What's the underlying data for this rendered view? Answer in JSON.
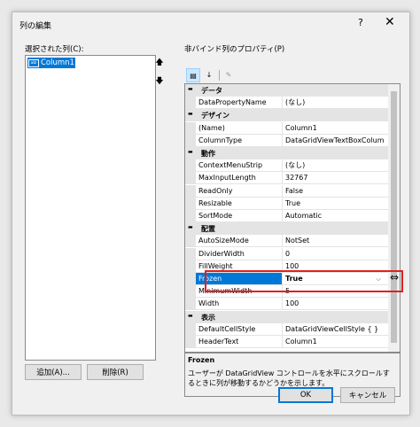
{
  "dialog": {
    "title": "列の編集",
    "help_label": "?",
    "close_label": "✕"
  },
  "left": {
    "label": "選択された列(C):",
    "items": [
      {
        "label": "Column1",
        "icon": "abl"
      }
    ],
    "up_label": "🡅",
    "down_label": "🡇",
    "add_button": "追加(A)...",
    "remove_button": "削除(R)"
  },
  "right": {
    "label": "非バインド列のプロパティ(P)",
    "toolbar": {
      "categorized_icon": "categorized-icon",
      "alphabetical_icon": "alphabetical-icon",
      "property_pages_icon": "wrench-icon"
    }
  },
  "grid": {
    "rows": [
      {
        "type": "cat",
        "label": "データ"
      },
      {
        "type": "prop",
        "name": "DataPropertyName",
        "value": "(なし)"
      },
      {
        "type": "cat",
        "label": "デザイン"
      },
      {
        "type": "prop",
        "name": "(Name)",
        "value": "Column1"
      },
      {
        "type": "prop",
        "name": "ColumnType",
        "value": "DataGridViewTextBoxColum"
      },
      {
        "type": "cat",
        "label": "動作"
      },
      {
        "type": "prop",
        "name": "ContextMenuStrip",
        "value": "(なし)"
      },
      {
        "type": "prop",
        "name": "MaxInputLength",
        "value": "32767"
      },
      {
        "type": "prop",
        "name": "ReadOnly",
        "value": "False"
      },
      {
        "type": "prop",
        "name": "Resizable",
        "value": "True"
      },
      {
        "type": "prop",
        "name": "SortMode",
        "value": "Automatic"
      },
      {
        "type": "cat",
        "label": "配置"
      },
      {
        "type": "prop",
        "name": "AutoSizeMode",
        "value": "NotSet"
      },
      {
        "type": "prop",
        "name": "DividerWidth",
        "value": "0"
      },
      {
        "type": "prop",
        "name": "FillWeight",
        "value": "100"
      },
      {
        "type": "prop",
        "name": "Frozen",
        "value": "True",
        "selected": true
      },
      {
        "type": "prop",
        "name": "MinimumWidth",
        "value": "5"
      },
      {
        "type": "prop",
        "name": "Width",
        "value": "100"
      },
      {
        "type": "cat",
        "label": "表示"
      },
      {
        "type": "prop",
        "name": "DefaultCellStyle",
        "value": "DataGridViewCellStyle { }"
      },
      {
        "type": "prop",
        "name": "HeaderText",
        "value": "Column1"
      }
    ]
  },
  "description": {
    "title": "Frozen",
    "text": "ユーザーが DataGridView コントロールを水平にスクロールするときに列が移動するかどうかを示します。"
  },
  "buttons": {
    "ok": "OK",
    "cancel": "キャンセル"
  },
  "colors": {
    "selection": "#0078d7",
    "highlight_box": "#e02020",
    "category_bg": "#e4e4e4"
  }
}
